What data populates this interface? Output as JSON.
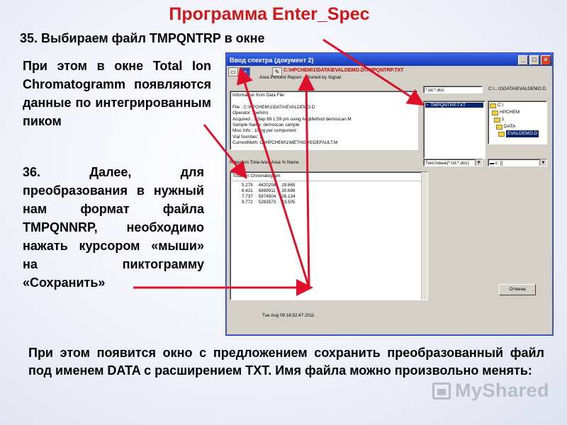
{
  "slide": {
    "title": "Программа Enter_Spec",
    "step35": "35. Выбираем файл TMPQNTRP в окне",
    "para1": "При этом в окне Total Ion Chromatogramm появляются данные по интегрированным пиком",
    "para2": "36. Далее, для преобразования в нужный нам формат файла TMPQNNRP, необходимо нажать курсором «мыши» на пиктограмму «Сохранить»",
    "para3": "При этом появится окно с предложением сохранить преобразованный файл под именем DATA с расширением TXT. Имя файла можно произвольно менять:",
    "watermark": "MyShared"
  },
  "window": {
    "title": "Ввод спектра (документ 2)",
    "path_red": "C:\\HPCHEM\\1\\DATA\\EVALDEMO.D\\TMPQNTRP.TXT",
    "subtitle": "Area Percent Report -- Sorted by Signal",
    "info": {
      "header": "Information from Data File:",
      "lines": [
        "File      : C:\\HPCHEM\\1\\DATA\\EVALDEMO.D",
        "Operator   : perkins",
        "Acquired   :  7 Sep 89   1:59 pm using AcqMethod demoscan.M",
        "Sample Name: demoscan sample",
        "Misc Info  : 10.ng per component",
        "Vial Number: 1",
        "CurrentMeth: C:\\HPCHEM\\1\\METHODS\\DEFAULT.M"
      ]
    },
    "columns_header": "Retention Time  Area  Area %   Name",
    "chrom_caption": "Total Ion Chromatogram",
    "rows": [
      [
        "5.278",
        "4420256",
        "19.665"
      ],
      [
        "6.431",
        "6899911",
        "30.696"
      ],
      [
        "7.737",
        "5874504",
        "26.134"
      ],
      [
        "9.772",
        "5283573",
        "23.505"
      ]
    ],
    "status": "Tue Aug 09 16:52:47 2011",
    "filter_value": "*.txt;*.doc",
    "dir_path": "C:\\...\\1\\DATA\\EVALDEMO.D",
    "file_item": "TMPQNTRP.TXT",
    "tree": [
      "C:\\",
      "HPCHEM",
      "1",
      "DATA",
      "EVALDEMO.D"
    ],
    "file_type": "Текстовые(*.txt;*.doc)",
    "drive": "c: []",
    "cancel_label": "Отмена"
  }
}
